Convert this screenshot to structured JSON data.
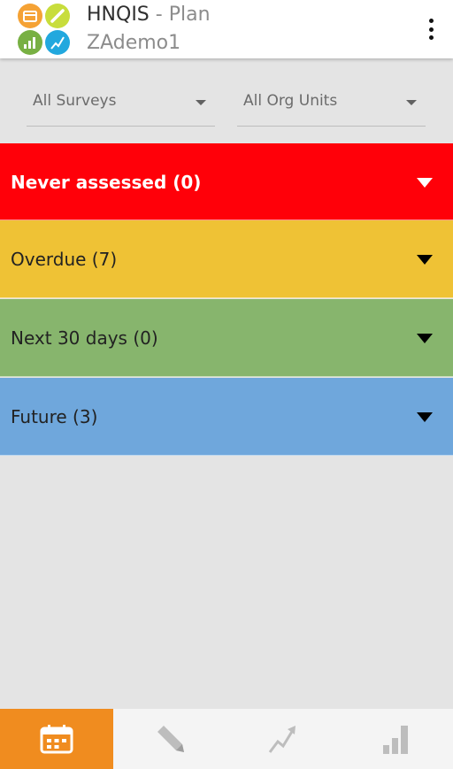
{
  "app_bar": {
    "app_name": "HNQIS",
    "separator": " - ",
    "screen_title": "Plan",
    "subtitle": "ZAdemo1",
    "overflow_menu_icon": "more-vert-icon"
  },
  "filters": {
    "surveys": {
      "value": "All Surveys"
    },
    "org_units": {
      "value": "All Org Units"
    }
  },
  "sections": [
    {
      "label": "Never assessed (0)",
      "color": "#ff0009"
    },
    {
      "label": "Overdue (7)",
      "color": "#efc235"
    },
    {
      "label": "Next 30 days (0)",
      "color": "#87b56d"
    },
    {
      "label": "Future (3)",
      "color": "#6fa7dc"
    }
  ],
  "tabs": [
    {
      "icon": "calendar-icon",
      "active": true
    },
    {
      "icon": "pencil-icon",
      "active": false
    },
    {
      "icon": "trend-icon",
      "active": false
    },
    {
      "icon": "bar-chart-icon",
      "active": false
    }
  ],
  "colors": {
    "active_tab": "#f08c1f",
    "logo_orange": "#f5a235",
    "logo_lime": "#c8dd3c",
    "logo_green": "#78b043",
    "logo_blue": "#22a8de"
  }
}
